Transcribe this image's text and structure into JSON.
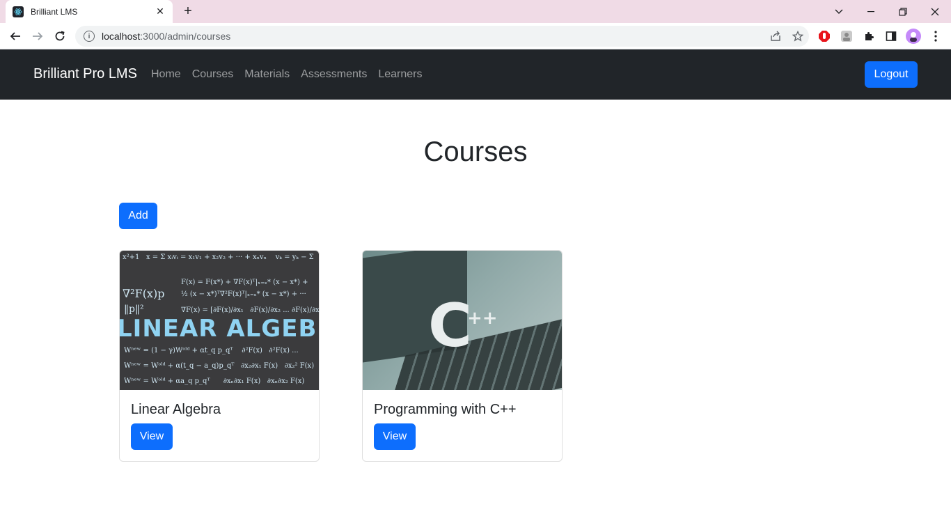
{
  "browser": {
    "tab_title": "Brilliant LMS",
    "url_host": "localhost",
    "url_path": ":3000/admin/courses"
  },
  "navbar": {
    "brand": "Brilliant Pro LMS",
    "links": [
      "Home",
      "Courses",
      "Materials",
      "Assessments",
      "Learners"
    ],
    "logout_label": "Logout"
  },
  "main": {
    "title": "Courses",
    "add_label": "Add",
    "courses": [
      {
        "title": "Linear Algebra",
        "view_label": "View",
        "image_text": "LINEAR ALGEBRA"
      },
      {
        "title": "Programming with C++",
        "view_label": "View",
        "image_text": "C++"
      }
    ]
  },
  "colors": {
    "primary": "#0d6efd",
    "navbar_bg": "#212529",
    "tabstrip_bg": "#f0dbe6"
  }
}
